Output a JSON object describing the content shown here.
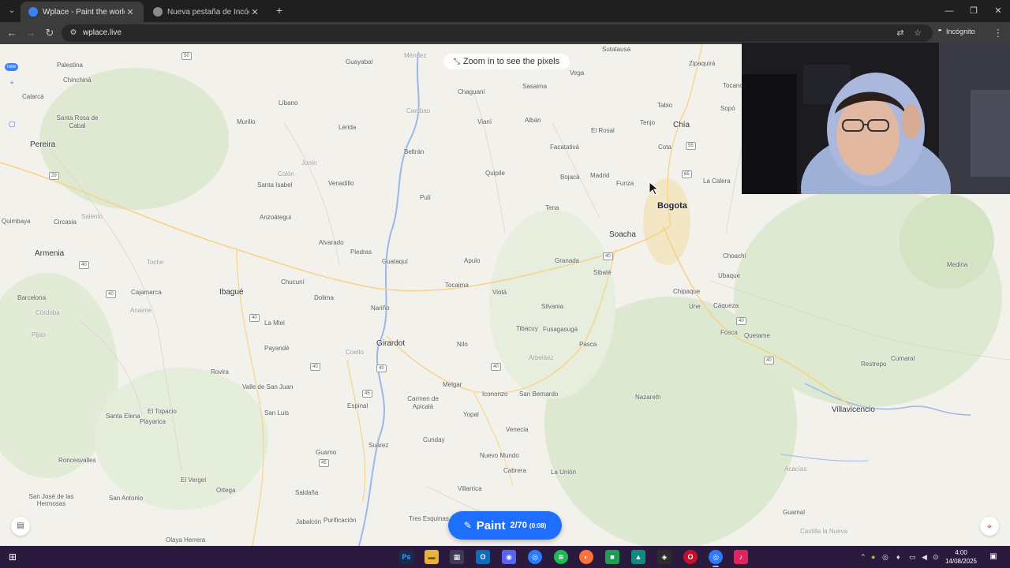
{
  "browser": {
    "tabs": [
      {
        "title": "Wplace - Paint the world",
        "active": true
      },
      {
        "title": "Nueva pestaña de Incógnito",
        "active": false
      }
    ],
    "new_tab_symbol": "+",
    "url": "wplace.live",
    "incognito_label": "Incógnito"
  },
  "map": {
    "zoom_hint": "Zoom in to see the pixels",
    "new_badge": "new",
    "places": [
      {
        "name": "Palestina"
      },
      {
        "name": "Chinchiná"
      },
      {
        "name": "Santa Rosa de Cabal"
      },
      {
        "name": "Pereira"
      },
      {
        "name": "Quimbaya"
      },
      {
        "name": "Circasia"
      },
      {
        "name": "Salento"
      },
      {
        "name": "Armenia"
      },
      {
        "name": "Barcelona"
      },
      {
        "name": "Córdoba"
      },
      {
        "name": "Pijao"
      },
      {
        "name": "Calarcá"
      },
      {
        "name": "Cajamarca"
      },
      {
        "name": "Anaime"
      },
      {
        "name": "Toche"
      },
      {
        "name": "Ibagué"
      },
      {
        "name": "Coello"
      },
      {
        "name": "Rovira"
      },
      {
        "name": "Valle de San Juan"
      },
      {
        "name": "San Luis"
      },
      {
        "name": "Santa Isabel"
      },
      {
        "name": "Anzoátegui"
      },
      {
        "name": "Venadillo"
      },
      {
        "name": "Alvarado"
      },
      {
        "name": "Piedras"
      },
      {
        "name": "Líbano"
      },
      {
        "name": "Murillo"
      },
      {
        "name": "Lérida"
      },
      {
        "name": "Guayabal"
      },
      {
        "name": "Méndez"
      },
      {
        "name": "Cambao"
      },
      {
        "name": "Beltrán"
      },
      {
        "name": "Guataquí"
      },
      {
        "name": "Nariño"
      },
      {
        "name": "Girardot"
      },
      {
        "name": "Nilo"
      },
      {
        "name": "Tocaima"
      },
      {
        "name": "Apulo"
      },
      {
        "name": "Viotá"
      },
      {
        "name": "Tibacuy"
      },
      {
        "name": "Fusagasugá"
      },
      {
        "name": "Arbeláez"
      },
      {
        "name": "Pasca"
      },
      {
        "name": "Silvania"
      },
      {
        "name": "Granada"
      },
      {
        "name": "Sibaté"
      },
      {
        "name": "Soacha"
      },
      {
        "name": "Bogota"
      },
      {
        "name": "Chaguaní"
      },
      {
        "name": "Vianí"
      },
      {
        "name": "Albán"
      },
      {
        "name": "Quipile"
      },
      {
        "name": "Sasaima"
      },
      {
        "name": "Vega"
      },
      {
        "name": "Facatativá"
      },
      {
        "name": "El Rosal"
      },
      {
        "name": "Bojacá"
      },
      {
        "name": "Madrid"
      },
      {
        "name": "Funza"
      },
      {
        "name": "Tena"
      },
      {
        "name": "Tenjo"
      },
      {
        "name": "Tabio"
      },
      {
        "name": "Chía"
      },
      {
        "name": "Cota"
      },
      {
        "name": "Zipaquirá"
      },
      {
        "name": "Sopó"
      },
      {
        "name": "Tocancipá"
      },
      {
        "name": "La Calera"
      },
      {
        "name": "Chipaque"
      },
      {
        "name": "Choachí"
      },
      {
        "name": "Ubaque"
      },
      {
        "name": "Une"
      },
      {
        "name": "Cáqueza"
      },
      {
        "name": "Fosca"
      },
      {
        "name": "Quetame"
      },
      {
        "name": "Cumaral"
      },
      {
        "name": "Restrepo"
      },
      {
        "name": "Villavicencio"
      },
      {
        "name": "Medina"
      },
      {
        "name": "Nazareth"
      },
      {
        "name": "Melgar"
      },
      {
        "name": "Icononzo"
      },
      {
        "name": "San Bernardo"
      },
      {
        "name": "Carmen de Apicalá"
      },
      {
        "name": "Espinal"
      },
      {
        "name": "Suárez"
      },
      {
        "name": "Cunday"
      },
      {
        "name": "Venecia"
      },
      {
        "name": "Nuevo Mundo"
      },
      {
        "name": "Cabrera"
      },
      {
        "name": "La Unión"
      },
      {
        "name": "Villarrica"
      },
      {
        "name": "Tres Esquinas"
      },
      {
        "name": "Guamo"
      },
      {
        "name": "Saldaña"
      },
      {
        "name": "Purificación"
      },
      {
        "name": "Jabalcón"
      },
      {
        "name": "Ortega"
      },
      {
        "name": "El Vergel"
      },
      {
        "name": "Roncesvalles"
      },
      {
        "name": "Santa Elena"
      },
      {
        "name": "El Topacio"
      },
      {
        "name": "Playarica"
      },
      {
        "name": "San José de las Hermosas"
      },
      {
        "name": "San Antonio"
      },
      {
        "name": "Olaya Herrera"
      },
      {
        "name": "Dolima"
      },
      {
        "name": "La Mlel"
      },
      {
        "name": "Payandé"
      },
      {
        "name": "Chucuní"
      },
      {
        "name": "Colón"
      },
      {
        "name": "Junín"
      },
      {
        "name": "Pulí"
      },
      {
        "name": "Yopal"
      },
      {
        "name": "Sutatausa"
      },
      {
        "name": "Guamal"
      },
      {
        "name": "Castilla la Nueva"
      },
      {
        "name": "Acacías"
      }
    ],
    "road_shields": [
      "50",
      "29",
      "40",
      "45",
      "55",
      "65"
    ],
    "paint_button": {
      "label": "Paint",
      "count": "2/70",
      "timer": "(0:08)"
    }
  },
  "taskbar": {
    "apps": [
      {
        "name": "photoshop",
        "glyph": "Ps"
      },
      {
        "name": "file-explorer",
        "glyph": "▬"
      },
      {
        "name": "apps",
        "glyph": "▦"
      },
      {
        "name": "outlook",
        "glyph": "O"
      },
      {
        "name": "discord",
        "glyph": "◉"
      },
      {
        "name": "chrome",
        "glyph": "◎"
      },
      {
        "name": "spotify",
        "glyph": "≋"
      },
      {
        "name": "firefox",
        "glyph": "◐"
      },
      {
        "name": "app-green",
        "glyph": "■"
      },
      {
        "name": "app-teal",
        "glyph": "▲"
      },
      {
        "name": "app-dark",
        "glyph": "◈"
      },
      {
        "name": "opera",
        "glyph": "O"
      },
      {
        "name": "chrome-active",
        "glyph": "◎"
      },
      {
        "name": "tiktok",
        "glyph": "♪"
      }
    ],
    "time": "4:00",
    "date": "14/08/2025"
  },
  "colors": {
    "paint_button": "#1f6fff",
    "map_bg": "#f3f1ec",
    "taskbar": "#2a1a3e"
  }
}
